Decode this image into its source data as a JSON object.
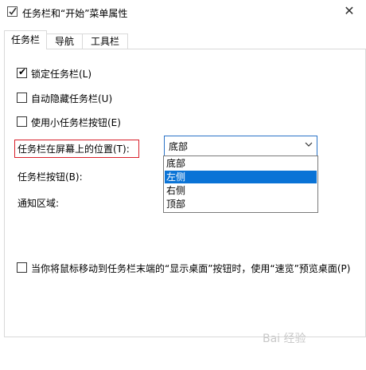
{
  "window": {
    "title": "任务栏和“开始”菜单属性",
    "close_glyph": "✕"
  },
  "tabs": [
    {
      "label": "任务栏",
      "active": true
    },
    {
      "label": "导航",
      "active": false
    },
    {
      "label": "工具栏",
      "active": false
    }
  ],
  "options": {
    "lock_taskbar": {
      "label": "锁定任务栏(L)",
      "checked": true
    },
    "auto_hide": {
      "label": "自动隐藏任务栏(U)",
      "checked": false
    },
    "small_buttons": {
      "label": "使用小任务栏按钮(E)",
      "checked": false
    },
    "peek": {
      "label": "当你将鼠标移动到任务栏末端的“显示桌面”按钮时，使用“速览”预览桌面(P)",
      "checked": false
    }
  },
  "labels": {
    "position": "任务栏在屏幕上的位置(T):",
    "buttons": "任务栏按钮(B):",
    "notification": "通知区域:"
  },
  "position_select": {
    "value": "底部",
    "options": [
      "底部",
      "左侧",
      "右侧",
      "顶部"
    ],
    "highlighted": "左侧"
  },
  "watermark": {
    "text": "Bai 经验"
  },
  "colors": {
    "accent": "#0a73d6",
    "highlight_box": "#d9202a",
    "combo_border": "#2b74c7"
  }
}
